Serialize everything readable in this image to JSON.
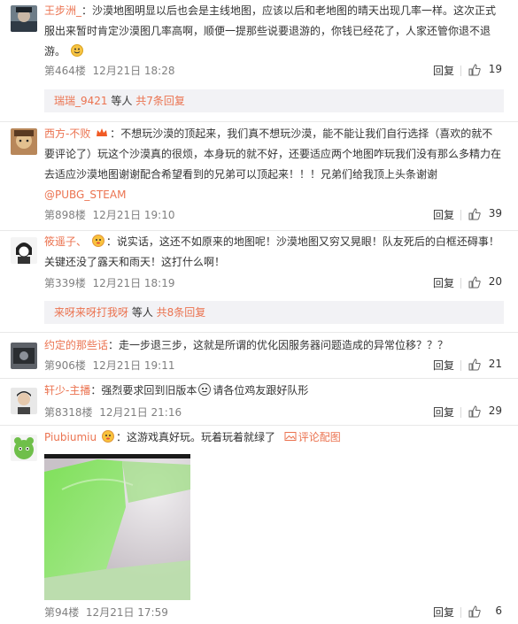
{
  "comments": [
    {
      "username": "王步洲_",
      "text": "沙漠地图明显以后也会是主线地图，应该以后和老地图的晴天出现几率一样。这次正式服出来暂时肯定沙漠图几率高啊，顺便一提那些说要退游的，你钱已经花了，人家还管你退不退游。",
      "floor": "第464楼",
      "time": "12月21日 18:28",
      "reply": "回复",
      "likes": "19",
      "sub": {
        "names": "瑞瑞_9421",
        "sep": " 等人 ",
        "count": "共7条回复"
      }
    },
    {
      "username": "西方-不败",
      "text": "不想玩沙漠的顶起来，我们真不想玩沙漠，能不能让我们自行选择（喜欢的就不要评论了）玩这个沙漠真的很烦，本身玩的就不好，还要适应两个地图咋玩我们没有那么多精力在去适应沙漠地图谢谢配合希望看到的兄弟可以顶起来！！！兄弟们给我顶上头条谢谢",
      "mention": "@PUBG_STEAM",
      "floor": "第898楼",
      "time": "12月21日 19:10",
      "reply": "回复",
      "likes": "39"
    },
    {
      "username": "筱遥子、",
      "text": "说实话，这还不如原来的地图呢！沙漠地图又穷又晃眼！队友死后的白框还碍事！关键还没了露天和雨天！这打什么啊！",
      "floor": "第339楼",
      "time": "12月21日 18:19",
      "reply": "回复",
      "likes": "20",
      "sub": {
        "names": "来呀来呀打我呀",
        "sep": " 等人 ",
        "count": "共8条回复"
      }
    },
    {
      "username": "约定的那些话",
      "text": "走一步退三步，这就是所谓的优化因服务器问题造成的异常位移？？？",
      "floor": "第906楼",
      "time": "12月21日 19:11",
      "reply": "回复",
      "likes": "21"
    },
    {
      "username": "轩少-主播",
      "text_a": "强烈要求回到旧版本",
      "text_b": "请各位鸡友跟好队形",
      "floor": "第8318楼",
      "time": "12月21日 21:16",
      "reply": "回复",
      "likes": "29"
    },
    {
      "username": "Piubiumiu",
      "text": "这游戏真好玩。玩着玩着就绿了",
      "pic_link": "评论配图",
      "floor": "第94楼",
      "time": "12月21日 17:59",
      "reply": "回复",
      "likes": "6"
    }
  ],
  "colors": {
    "accent": "#eb7350",
    "sub_bg": "#f2f2f5",
    "meta": "#808080"
  },
  "icons": {
    "like": "thumbs-up-icon",
    "crown": "crown-icon",
    "picture": "picture-icon"
  }
}
